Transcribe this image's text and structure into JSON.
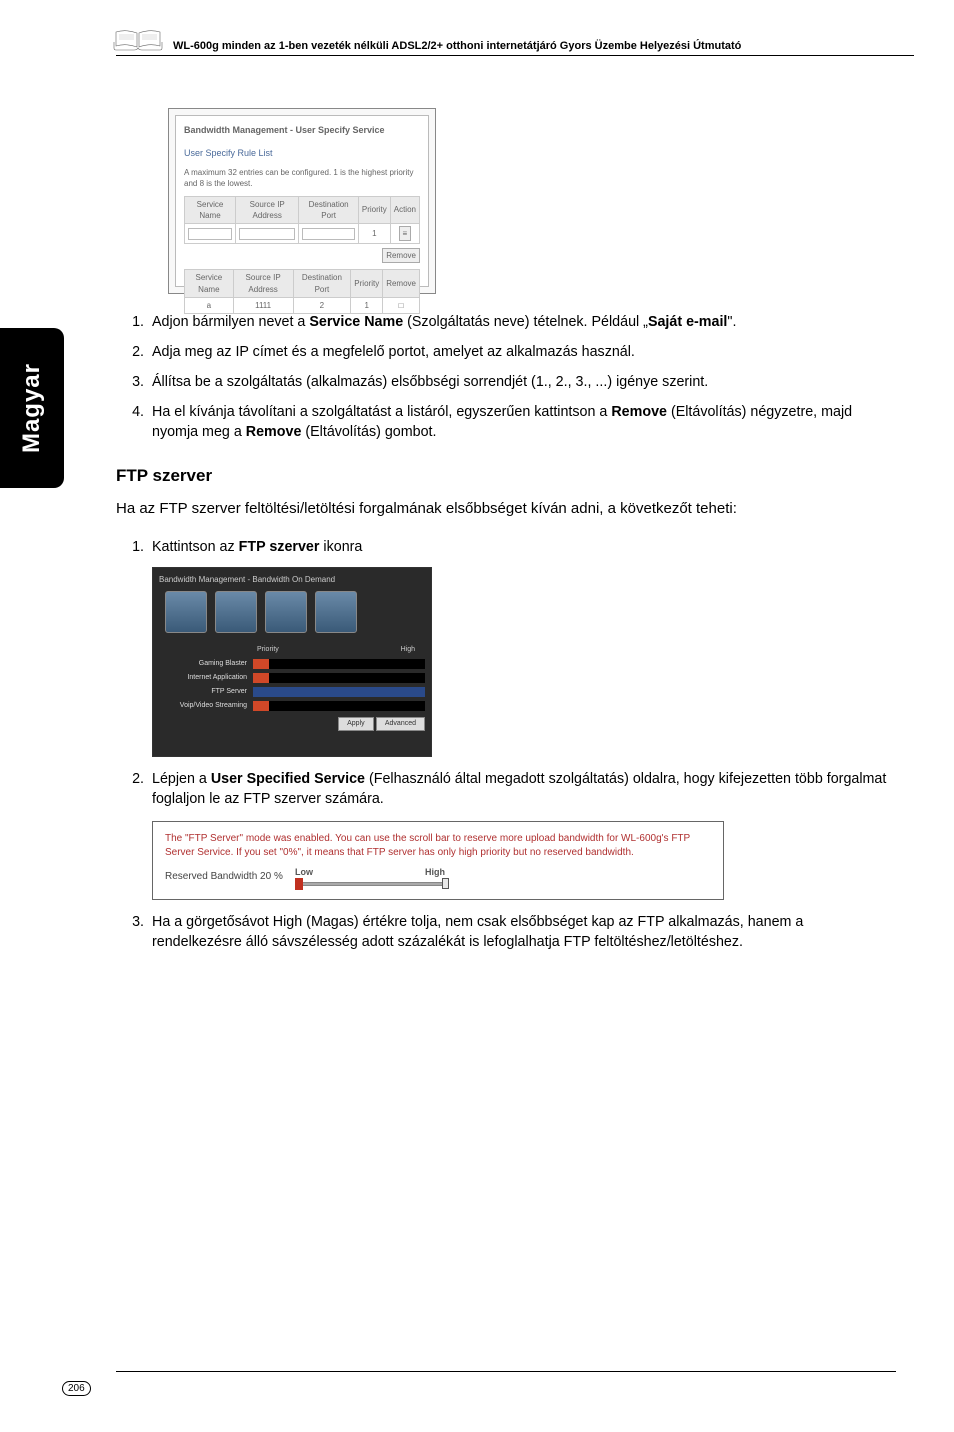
{
  "header": "WL-600g minden az 1-ben vezeték nélküli ADSL2/2+ otthoni internetátjáró Gyors Üzembe Helyezési Útmutató",
  "side_tab": "Magyar",
  "ss1": {
    "title": "Bandwidth Management - User Specify Service",
    "subtitle": "User Specify Rule List",
    "note": "A maximum 32 entries can be configured. 1 is the highest priority and 8 is the lowest.",
    "cols1": [
      "Service Name",
      "Source IP Address",
      "Destination Port",
      "Priority",
      "Action"
    ],
    "priority_val": "1",
    "remove_btn": "Remove",
    "cols2": [
      "Service Name",
      "Source IP Address",
      "Destination Port",
      "Priority",
      "Remove"
    ],
    "row2": [
      "a",
      "1111",
      "2",
      "1",
      "□"
    ]
  },
  "list1": [
    {
      "pre": "Adjon bármilyen nevet a ",
      "b1": "Service Name",
      "mid1": " (Szolgáltatás neve) tételnek. Például „",
      "b2": "Saját e-mail",
      "post": "\"."
    },
    {
      "text": "Adja meg az IP címet és a megfelelő portot, amelyet az alkalmazás használ."
    },
    {
      "text": "Állítsa be a szolgáltatás (alkalmazás) elsőbbségi sorrendjét (1., 2., 3., ...) igénye szerint."
    },
    {
      "pre": "Ha el kívánja távolítani a szolgáltatást a listáról, egyszerűen kattintson a ",
      "b1": "Remove",
      "mid1": " (Eltávolítás) négyzetre, majd nyomja meg a ",
      "b2": "Remove",
      "post": " (Eltávolítás) gombot."
    }
  ],
  "section_title": "FTP szerver",
  "intro": "Ha az FTP szerver feltöltési/letöltési forgalmának elsőbbséget kíván adni, a következőt teheti:",
  "list2_item1": {
    "pre": "Kattintson az ",
    "b": "FTP szerver",
    "post": " ikonra"
  },
  "ss2": {
    "title": "Bandwidth Management - Bandwidth On Demand",
    "header_priority": "Priority",
    "header_high": "High",
    "rows": [
      "Gaming Blaster",
      "Internet Application",
      "FTP Server",
      "Voip/Video Streaming"
    ],
    "apply": "Apply",
    "advanced": "Advanced"
  },
  "list2_item2": {
    "pre": "Lépjen a ",
    "b": "User Specified Service",
    "post": " (Felhasználó által megadott szolgáltatás) oldalra, hogy kifejezetten több forgalmat foglaljon le az FTP szerver számára."
  },
  "ss3": {
    "desc": "The \"FTP Server\" mode was enabled. You can use the scroll bar to reserve more upload bandwidth for WL-600g's FTP Server Service. If you set \"0%\", it means that FTP server has only high priority but no reserved bandwidth.",
    "low": "Low",
    "high": "High",
    "label": "Reserved Bandwidth 20  %"
  },
  "list2_item3": "Ha a görgetősávot High (Magas) értékre tolja, nem csak elsőbbséget kap az FTP alkalmazás, hanem a rendelkezésre álló sávszélesség adott százalékát is lefoglalhatja FTP feltöltéshez/letöltéshez.",
  "page_number": "206"
}
